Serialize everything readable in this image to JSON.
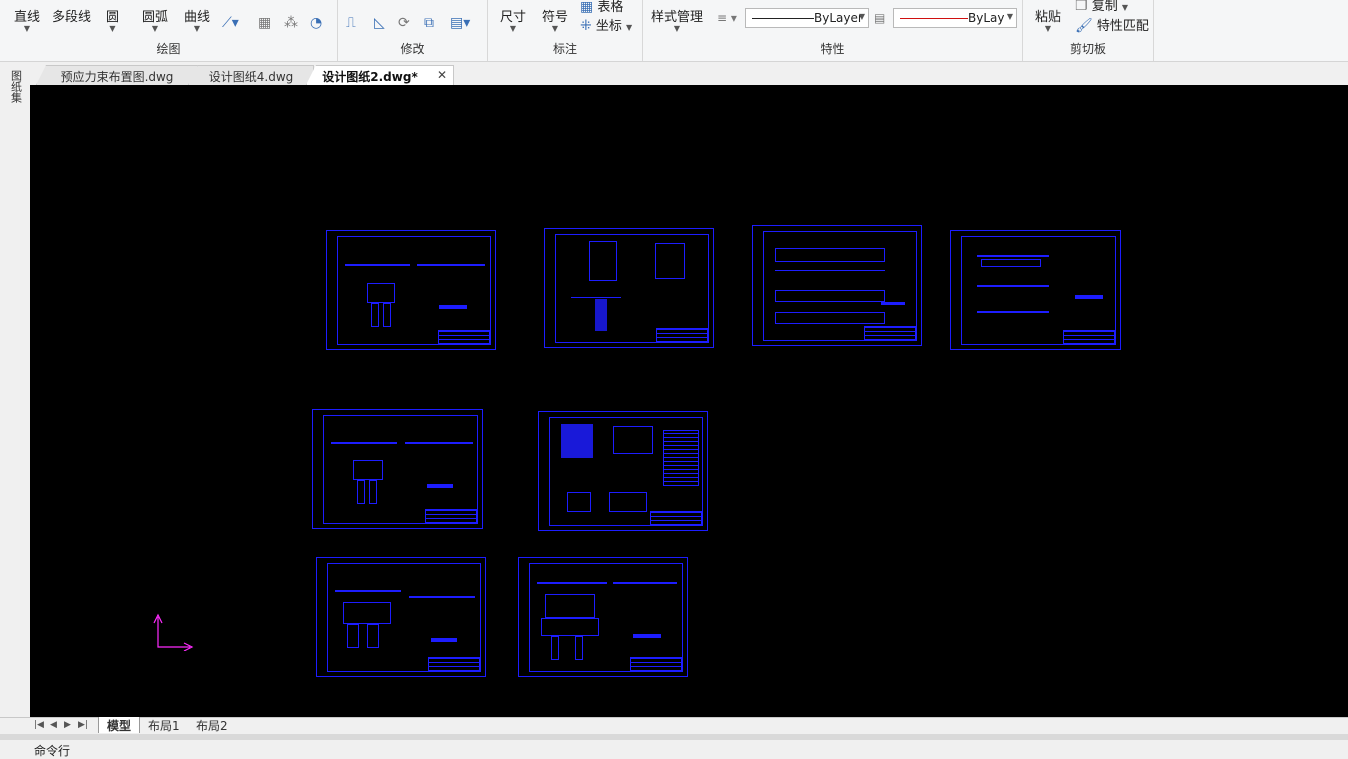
{
  "ribbon": {
    "draw_panel": {
      "title": "绘图",
      "line": "直线",
      "polyline": "多段线",
      "circle": "圆",
      "arc": "圆弧",
      "curve": "曲线"
    },
    "modify_panel": {
      "title": "修改"
    },
    "annotate_panel": {
      "title": "标注",
      "dimension": "尺寸",
      "symbol": "符号",
      "table": "表格",
      "coordinate": "坐标"
    },
    "properties_panel": {
      "title": "特性",
      "style_manager": "样式管理",
      "linetype_value": "ByLayer",
      "lineweight_value": "ByLayer"
    },
    "clipboard_panel": {
      "title": "剪切板",
      "paste": "粘贴",
      "copy": "复制",
      "match_properties": "特性匹配"
    }
  },
  "side_button": "图纸集",
  "doc_tabs": [
    {
      "label": "预应力束布置图.dwg",
      "active": false
    },
    {
      "label": "设计图纸4.dwg",
      "active": false
    },
    {
      "label": "设计图纸2.dwg*",
      "active": true
    }
  ],
  "layout_tabs": [
    {
      "label": "模型",
      "active": true
    },
    {
      "label": "布局1",
      "active": false
    },
    {
      "label": "布局2",
      "active": false
    }
  ],
  "command_line": "命令行",
  "colors": {
    "canvas": "#000000",
    "drawing_lines": "#1d1dff",
    "ucs_icon": "#ff2bff",
    "linetype_sample": "#222222",
    "lineweight_sample": "#d01010"
  }
}
